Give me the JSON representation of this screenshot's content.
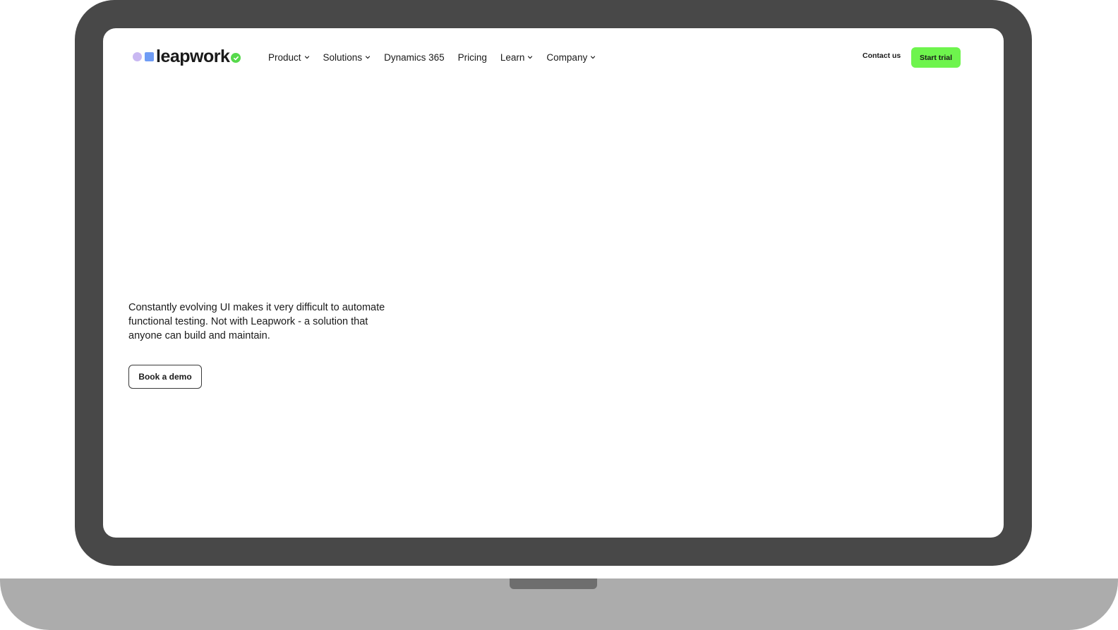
{
  "brand": {
    "name": "leapwork",
    "accent_green": "#6ef44d",
    "logo_dot_color": "#c9b8f2",
    "logo_square_color": "#6f9cf5",
    "logo_check_color": "#56d94b"
  },
  "nav": {
    "items": [
      {
        "label": "Product",
        "has_dropdown": true
      },
      {
        "label": "Solutions",
        "has_dropdown": true
      },
      {
        "label": "Dynamics 365",
        "has_dropdown": false
      },
      {
        "label": "Pricing",
        "has_dropdown": false
      },
      {
        "label": "Learn",
        "has_dropdown": true
      },
      {
        "label": "Company",
        "has_dropdown": true
      }
    ]
  },
  "header_actions": {
    "contact_label": "Contact us",
    "trial_label": "Start trial"
  },
  "hero": {
    "description": "Constantly evolving UI makes it very difficult to automate functional testing. Not with Leapwork - a solution that anyone can build and maintain.",
    "demo_button_label": "Book a demo"
  },
  "device": {
    "bezel_color": "#484848",
    "base_color": "#acacac"
  }
}
